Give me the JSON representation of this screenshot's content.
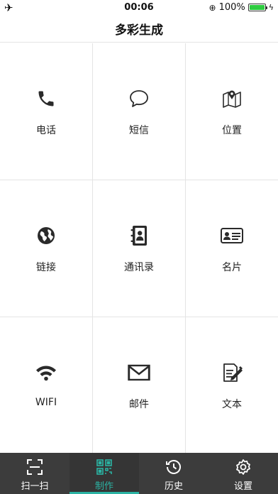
{
  "status_bar": {
    "airplane_icon": "airplane-icon",
    "time": "00:06",
    "battery_percent": "100%",
    "battery_level": 1.0,
    "battery_color": "#2ecc40"
  },
  "header": {
    "title": "多彩生成"
  },
  "grid": {
    "items": [
      {
        "label": "电话",
        "icon": "phone-icon"
      },
      {
        "label": "短信",
        "icon": "chat-bubble-icon"
      },
      {
        "label": "位置",
        "icon": "map-icon"
      },
      {
        "label": "链接",
        "icon": "globe-icon"
      },
      {
        "label": "通讯录",
        "icon": "contacts-book-icon"
      },
      {
        "label": "名片",
        "icon": "id-card-icon"
      },
      {
        "label": "WIFI",
        "icon": "wifi-icon"
      },
      {
        "label": "邮件",
        "icon": "mail-icon"
      },
      {
        "label": "文本",
        "icon": "edit-document-icon"
      }
    ]
  },
  "tab_bar": {
    "accent_color": "#2bb3a3",
    "items": [
      {
        "label": "扫一扫",
        "icon": "scan-icon",
        "active": false
      },
      {
        "label": "制作",
        "icon": "qr-code-icon",
        "active": true
      },
      {
        "label": "历史",
        "icon": "history-icon",
        "active": false
      },
      {
        "label": "设置",
        "icon": "gear-icon",
        "active": false
      }
    ]
  }
}
